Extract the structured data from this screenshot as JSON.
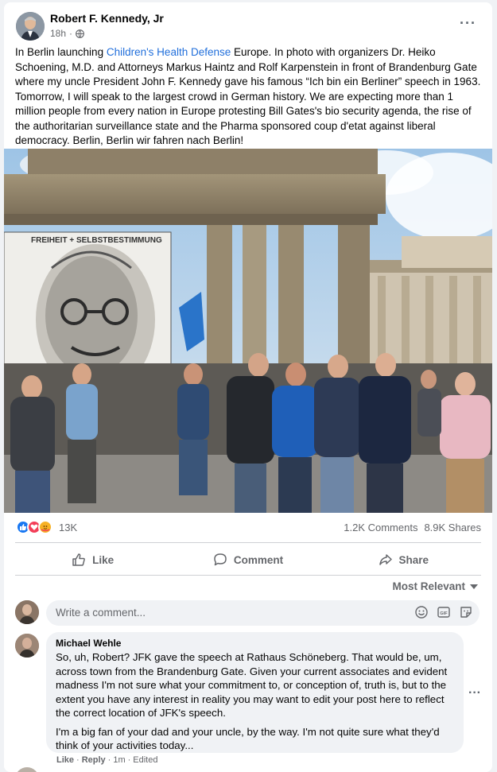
{
  "post": {
    "author": "Robert F. Kennedy, Jr",
    "time": "18h",
    "text_before_link": "In Berlin launching ",
    "link_text": "Children's Health Defense",
    "text_after_link": " Europe. In photo with organizers Dr. Heiko Schoening, M.D. and Attorneys Markus Haintz and Rolf Karpenstein in front of Brandenburg Gate where my uncle President John F. Kennedy gave his famous “Ich bin ein Berliner” speech in 1963. Tomorrow, I will speak to the largest crowd in German history. We are expecting more than 1 million people from every nation in Europe protesting Bill Gates's bio security agenda, the rise of the authoritarian surveillance state and the Pharma sponsored coup d'etat against liberal democracy. Berlin, Berlin wir fahren nach Berlin!",
    "banner_text": "FREIHEIT + SELBSTBESTIMMUNG"
  },
  "stats": {
    "reaction_count": "13K",
    "comments": "1.2K Comments",
    "shares": "8.9K Shares"
  },
  "actions": {
    "like": "Like",
    "comment": "Comment",
    "share": "Share"
  },
  "sort": {
    "label": "Most Relevant"
  },
  "composer": {
    "placeholder": "Write a comment..."
  },
  "comment": {
    "author": "Michael Wehle",
    "paragraph1": "So, uh, Robert? JFK gave the speech at Rathaus Schöneberg. That would be, um, across town from the Brandenburg Gate. Given your current associates and evident madness I'm not sure what your commitment to, or conception of, truth is, but to the extent you have any interest in reality you may want to edit your post here to reflect the correct location of JFK's speech.",
    "paragraph2": "I'm a big fan of your dad and your uncle, by the way. I'm not quite sure what they'd think of your activities today...",
    "like": "Like",
    "reply": "Reply",
    "time": "1m",
    "edited": "Edited"
  },
  "colors": {
    "link": "#216fdb",
    "like_blue": "#1877f2",
    "love_red": "#f33e58",
    "haha_yellow": "#f7b125"
  }
}
